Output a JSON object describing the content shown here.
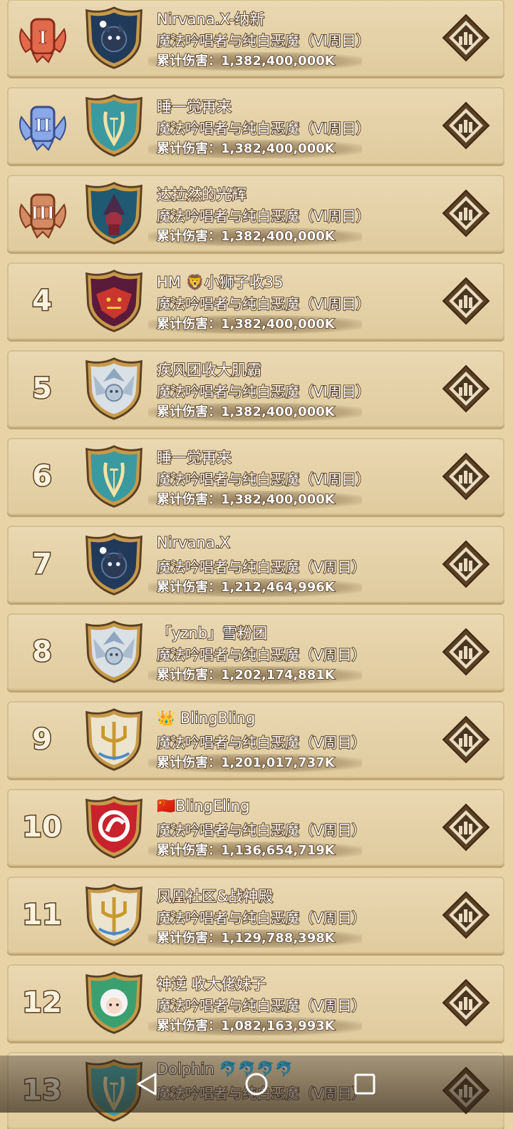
{
  "leaderboard": [
    {
      "rank": "1",
      "medal": "gold-medal",
      "crest": "dark-beast-crest",
      "name": "Nirvana.X-纳新",
      "stage": "魔法吟唱者与纯白恶魔（VI周目）",
      "damage": "累计伤害：1,382,400,000K"
    },
    {
      "rank": "2",
      "medal": "silver-medal",
      "crest": "lyre-crest",
      "name": "睡一觉再来",
      "stage": "魔法吟唱者与纯白恶魔（VI周目）",
      "damage": "累计伤害：1,382,400,000K"
    },
    {
      "rank": "3",
      "medal": "bronze-medal",
      "crest": "witch-crest",
      "name": "达拉然的光辉",
      "stage": "魔法吟唱者与纯白恶魔（VI周目）",
      "damage": "累计伤害：1,382,400,000K"
    },
    {
      "rank": "4",
      "medal": "",
      "crest": "dragon-crest",
      "name": "HM 🦁小狮子收35",
      "stage": "魔法吟唱者与纯白恶魔（VI周目）",
      "damage": "累计伤害：1,382,400,000K"
    },
    {
      "rank": "5",
      "medal": "",
      "crest": "winged-face-crest",
      "name": "疾风团收大肌霸",
      "stage": "魔法吟唱者与纯白恶魔（VI周目）",
      "damage": "累计伤害：1,382,400,000K"
    },
    {
      "rank": "6",
      "medal": "",
      "crest": "lyre-crest",
      "name": "睡一觉再来",
      "stage": "魔法吟唱者与纯白恶魔（VI周目）",
      "damage": "累计伤害：1,382,400,000K"
    },
    {
      "rank": "7",
      "medal": "",
      "crest": "dark-beast-crest",
      "name": "Nirvana.X",
      "stage": "魔法吟唱者与纯白恶魔（V周目）",
      "damage": "累计伤害：1,212,464,996K"
    },
    {
      "rank": "8",
      "medal": "",
      "crest": "winged-face-crest",
      "name": "「yznb」雪粉团",
      "stage": "魔法吟唱者与纯白恶魔（V周目）",
      "damage": "累计伤害：1,202,174,881K"
    },
    {
      "rank": "9",
      "medal": "",
      "crest": "trident-crest",
      "name": "👑 BlingBling",
      "stage": "魔法吟唱者与纯白恶魔（V周目）",
      "damage": "累计伤害：1,201,017,737K"
    },
    {
      "rank": "10",
      "medal": "",
      "crest": "red-dragon-crest",
      "name": "🇨🇳BlingEling",
      "stage": "魔法吟唱者与纯白恶魔（V周目）",
      "damage": "累计伤害：1,136,654,719K"
    },
    {
      "rank": "11",
      "medal": "",
      "crest": "trident-crest",
      "name": "凤凰社区&战神殿",
      "stage": "魔法吟唱者与纯白恶魔（V周目）",
      "damage": "累计伤害：1,129,788,398K"
    },
    {
      "rank": "12",
      "medal": "",
      "crest": "girl-crest",
      "name": "神逆 收大佬妹子",
      "stage": "魔法吟唱者与纯白恶魔（V周目）",
      "damage": "累计伤害：1,082,163,993K"
    },
    {
      "rank": "13",
      "medal": "",
      "crest": "lyre-crest",
      "name": "Dolphin 🐬🐬🐬🐬",
      "stage": "魔法吟唱者与纯白恶魔（V周目）",
      "damage": ""
    }
  ],
  "colors": {
    "panel": "#e4d0a4",
    "outline": "#5a3f22",
    "shield_border": "#c79a4a",
    "teal": "#3a9aa0",
    "navy": "#223a5a",
    "red": "#c8232c"
  }
}
